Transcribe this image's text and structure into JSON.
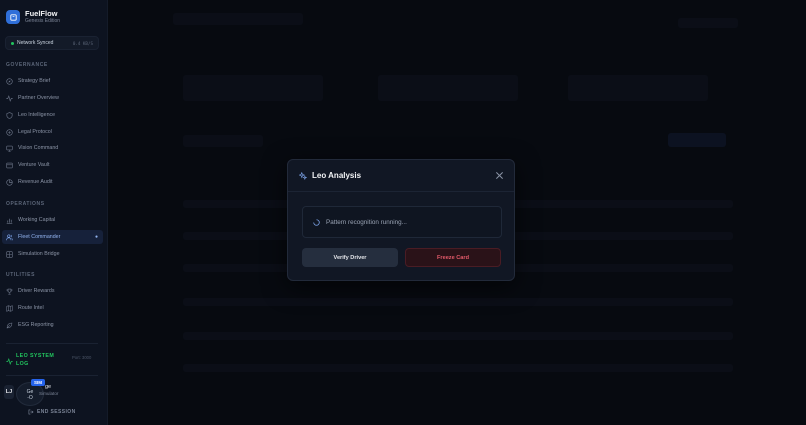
{
  "brand": {
    "title": "FuelFlow",
    "subtitle": "Genesis Edition"
  },
  "network": {
    "label": "Network Synced",
    "rate": "0.4 KB/S"
  },
  "sections": {
    "governance": "GOVERNANCE",
    "operations": "OPERATIONS",
    "utilities": "UTILITIES"
  },
  "nav": {
    "governance": [
      {
        "label": "Strategy Brief",
        "icon": "compass-icon"
      },
      {
        "label": "Partner Overview",
        "icon": "activity-icon"
      },
      {
        "label": "Leo Intelligence",
        "icon": "shield-icon"
      },
      {
        "label": "Legal Protocol",
        "icon": "scale-icon"
      },
      {
        "label": "Vision Command",
        "icon": "monitor-icon"
      },
      {
        "label": "Venture Vault",
        "icon": "vault-icon"
      },
      {
        "label": "Revenue Audit",
        "icon": "pie-icon"
      }
    ],
    "operations": [
      {
        "label": "Working Capital",
        "icon": "bar-chart-icon"
      },
      {
        "label": "Fleet Commander",
        "icon": "users-icon"
      },
      {
        "label": "Simulation Bridge",
        "icon": "grid-icon"
      }
    ],
    "utilities": [
      {
        "label": "Driver Rewards",
        "icon": "trophy-icon"
      },
      {
        "label": "Route Intel",
        "icon": "map-icon"
      },
      {
        "label": "ESG Reporting",
        "icon": "leaf-icon"
      }
    ]
  },
  "log": {
    "title": "LEO SYSTEM LOG",
    "meta": "Port: 3000"
  },
  "user": {
    "initials": "LJ",
    "avatar_text": "Ge\n-O",
    "badge": "SIM",
    "name": "ge",
    "role": "Simulator"
  },
  "end_session": "END SESSION",
  "modal": {
    "title": "Leo Analysis",
    "status": "Pattern recognition running...",
    "verify_label": "Verify Driver",
    "freeze_label": "Freeze Card"
  },
  "colors": {
    "accent": "#2f6fd9",
    "success": "#22c55e",
    "danger": "#e35a6a"
  }
}
